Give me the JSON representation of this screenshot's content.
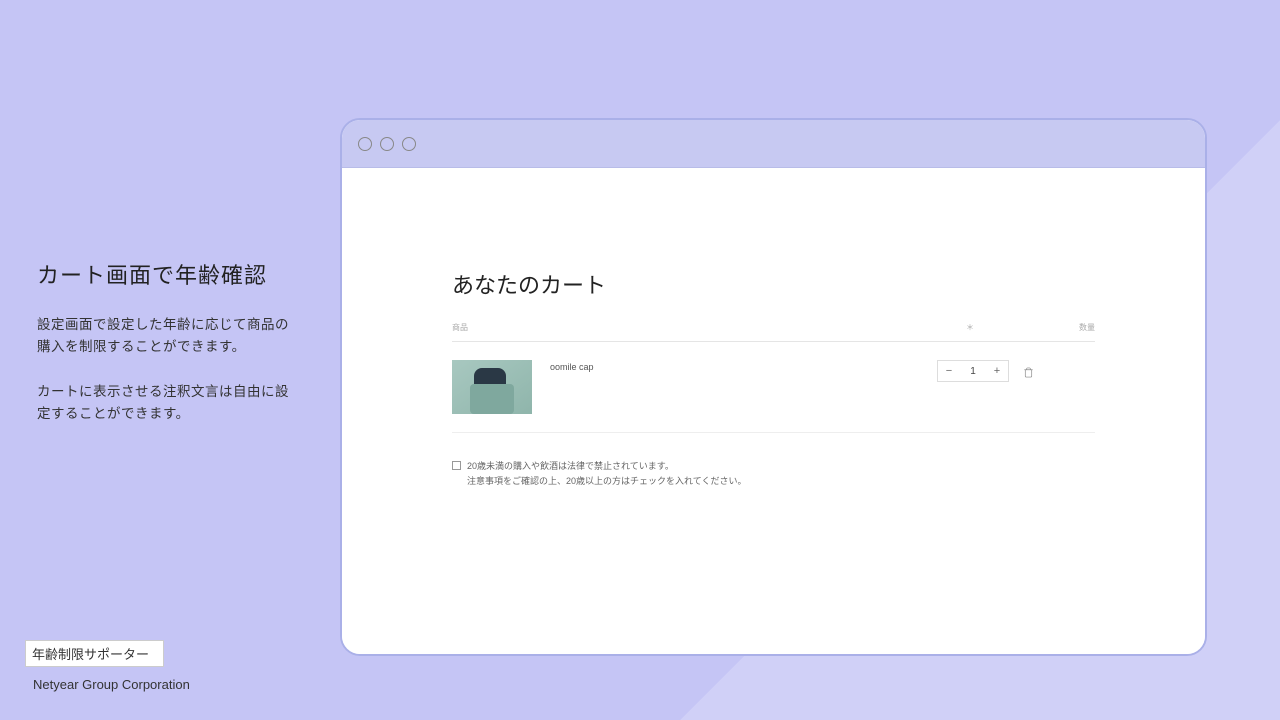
{
  "left": {
    "title": "カート画面で年齢確認",
    "desc1": "設定画面で設定した年齢に応じて商品の購入を制限することができます。",
    "desc2": "カートに表示させる注釈文言は自由に設定することができます。"
  },
  "footer": {
    "badge": "年齢制限サポーター",
    "company": "Netyear Group Corporation"
  },
  "cart": {
    "title": "あなたのカート",
    "col_product": "商品",
    "col_qty": "＊",
    "col_total": "数量",
    "item": {
      "name": "oomile cap",
      "qty": "1"
    },
    "age": {
      "line1": "20歳未満の購入や飲酒は法律で禁止されています。",
      "line2": "注意事項をご確認の上、20歳以上の方はチェックを入れてください。"
    }
  }
}
